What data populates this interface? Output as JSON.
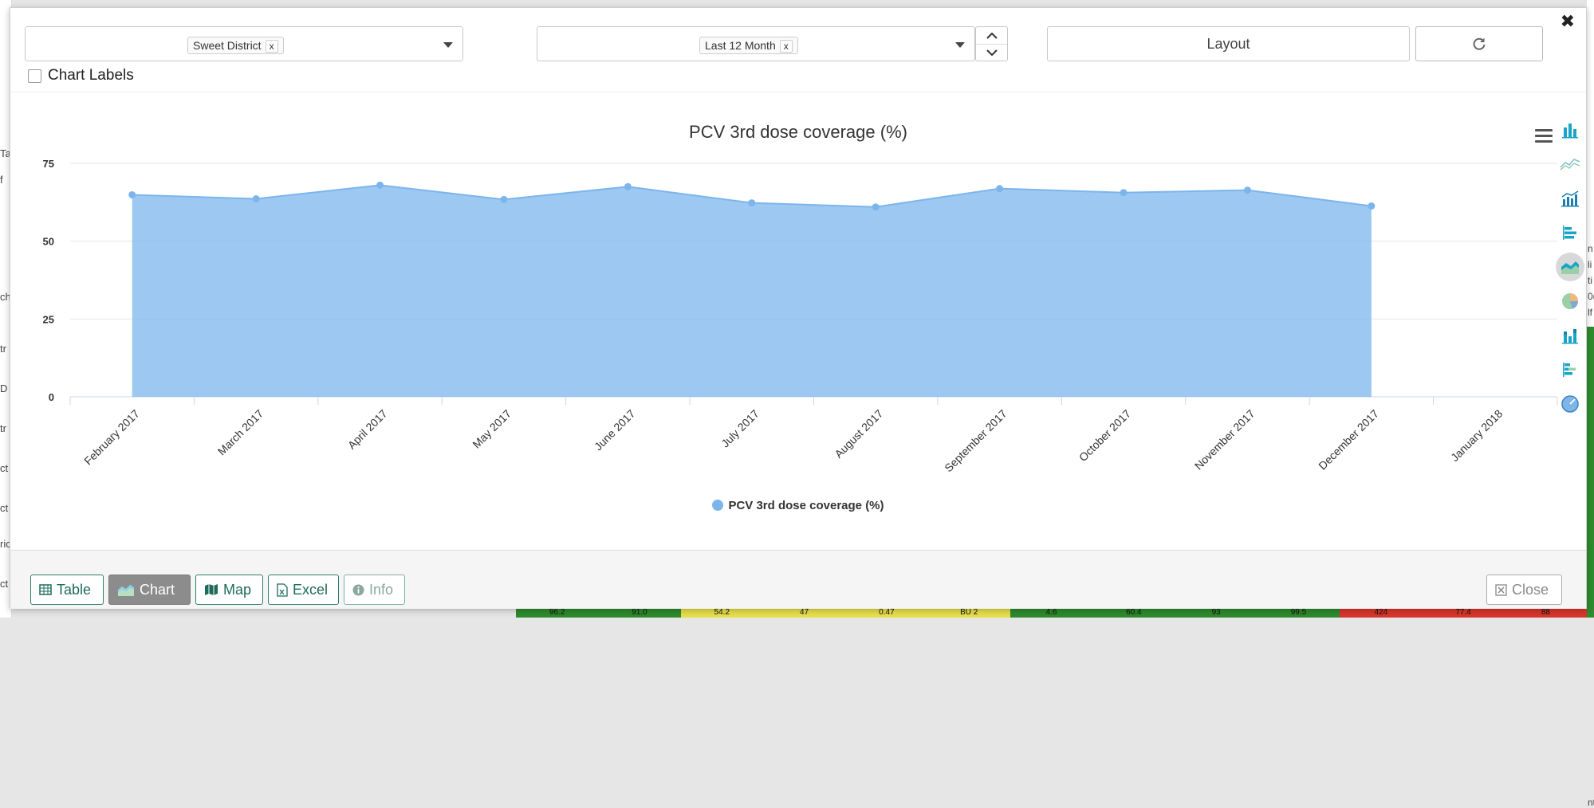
{
  "background": {
    "left_fragments": [
      "Ta",
      "f",
      "ch",
      "tr",
      "D",
      "tr",
      "ct",
      "ct",
      "ric",
      "ct"
    ],
    "right_fragments": [
      "n",
      "li",
      "ti",
      "0(",
      "lf",
      "nt"
    ],
    "bottom_cells": [
      {
        "text": "96.2",
        "color": "#2e8b2e"
      },
      {
        "text": "91.0",
        "color": "#2e8b2e"
      },
      {
        "text": "54.2",
        "color": "#e8e04a"
      },
      {
        "text": "47",
        "color": "#e8e04a"
      },
      {
        "text": "0.47",
        "color": "#e8e04a"
      },
      {
        "text": "BU 2",
        "color": "#e8e04a"
      },
      {
        "text": "4.6",
        "color": "#2e8b2e"
      },
      {
        "text": "60.4",
        "color": "#2e8b2e"
      },
      {
        "text": "93",
        "color": "#2e8b2e"
      },
      {
        "text": "99.5",
        "color": "#2e8b2e"
      },
      {
        "text": "424",
        "color": "#d9362b"
      },
      {
        "text": "77.4",
        "color": "#d9362b"
      },
      {
        "text": "88",
        "color": "#d9362b"
      }
    ]
  },
  "filters": {
    "org_unit": "Sweet District",
    "period": "Last 12 Month",
    "chip_remove": "x"
  },
  "toolbar": {
    "layout_label": "Layout",
    "chart_labels": "Chart Labels",
    "close_symbol": "✖"
  },
  "chart_data": {
    "type": "area",
    "title": "PCV 3rd dose coverage (%)",
    "categories": [
      "February 2017",
      "March 2017",
      "April 2017",
      "May 2017",
      "June 2017",
      "July 2017",
      "August 2017",
      "September 2017",
      "October 2017",
      "November 2017",
      "December 2017",
      "January 2018"
    ],
    "series": [
      {
        "name": "PCV 3rd dose coverage (%)",
        "values": [
          64.9,
          63.6,
          68.0,
          63.4,
          67.5,
          62.3,
          61.0,
          66.9,
          65.6,
          66.4,
          61.3,
          null
        ],
        "color": "#7cb5ec"
      }
    ],
    "yticks": [
      0,
      25,
      50,
      75
    ],
    "ylim": [
      0,
      75
    ],
    "grid": true,
    "legend_position": "bottom-center"
  },
  "footer": {
    "table": "Table",
    "chart": "Chart",
    "map": "Map",
    "excel": "Excel",
    "info": "Info",
    "close": "Close"
  },
  "icons": {
    "side": [
      "column-chart-icon",
      "line-chart-icon",
      "column-line-combo-icon",
      "bar-chart-icon",
      "area-chart-icon",
      "pie-chart-icon",
      "stacked-column-icon",
      "stacked-bar-icon",
      "gauge-icon"
    ]
  }
}
